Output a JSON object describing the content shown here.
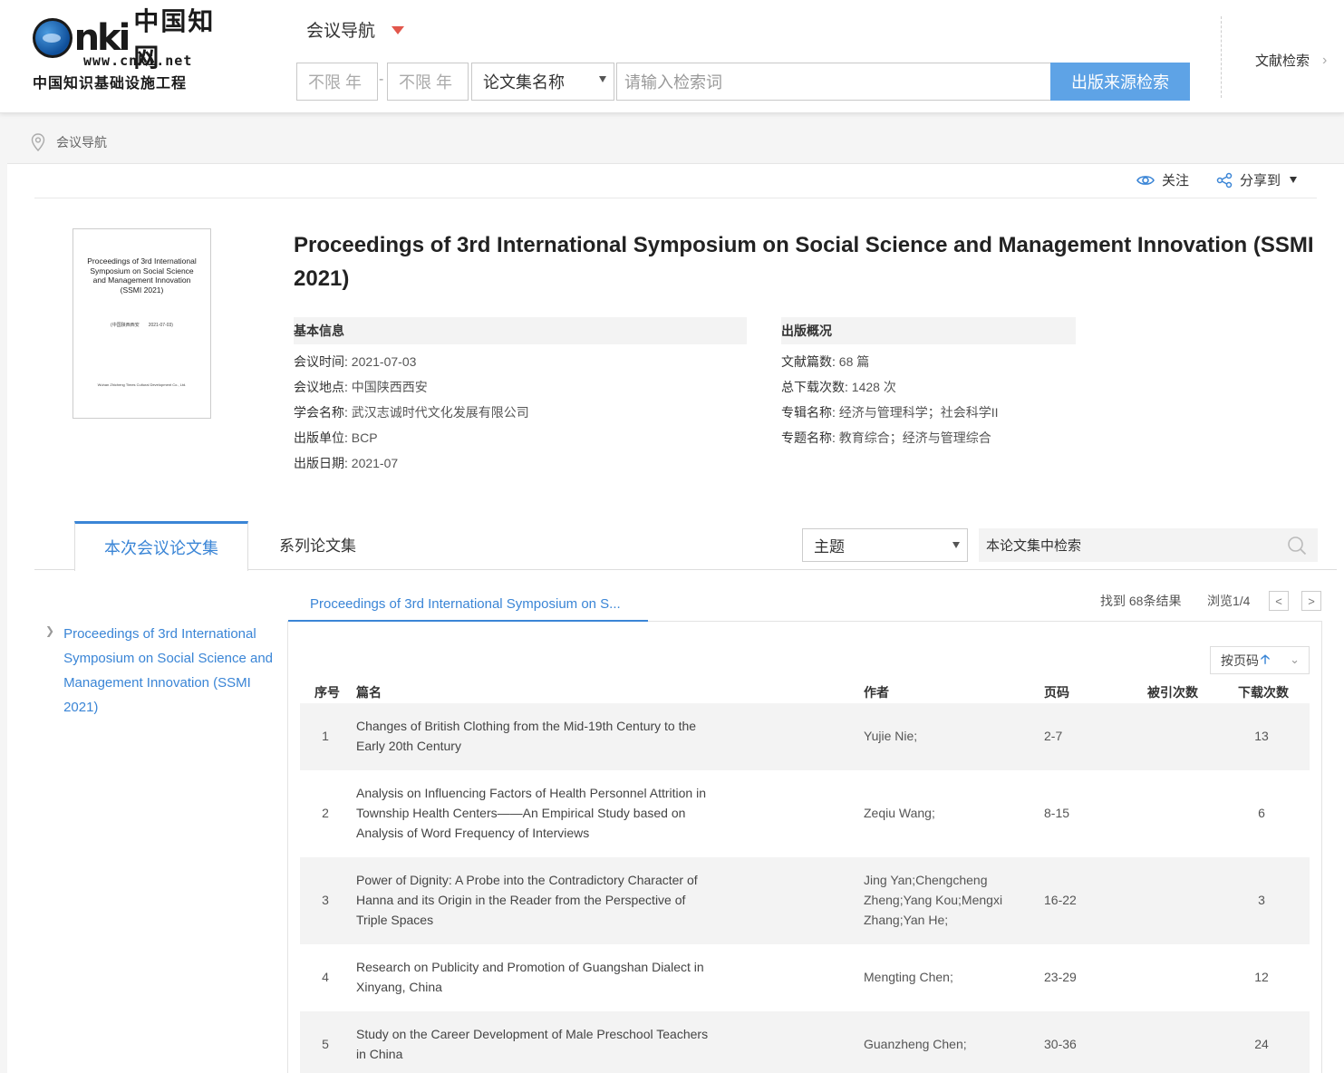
{
  "header": {
    "logo": {
      "brand": "CNKI",
      "cn_name": "中国知网",
      "url": "www.cnki.net",
      "slogan": "中国知识基础设施工程"
    },
    "nav_dropdown": "会议导航",
    "year_from": "不限 年",
    "year_to": "不限 年",
    "year_dash": "-",
    "field_select": "论文集名称",
    "keyword_placeholder": "请输入检索词",
    "search_button": "出版来源检索",
    "doc_search": "文献检索"
  },
  "breadcrumb": "会议导航",
  "actions": {
    "follow": "关注",
    "share": "分享到"
  },
  "cover": {
    "title": "Proceedings of 3rd International Symposium on Social Science and Management Innovation (SSMI 2021)",
    "location_line": "(中国陕西西安　　2021-07-03)",
    "publisher_line": "Wuhan Zhicheng Times Cultural Development Co., Ltd."
  },
  "title": "Proceedings of 3rd International Symposium on Social Science and Management Innovation (SSMI 2021)",
  "basic_info": {
    "heading": "基本信息",
    "items": [
      {
        "k": "会议时间:",
        "v": "2021-07-03"
      },
      {
        "k": "会议地点:",
        "v": "中国陕西西安"
      },
      {
        "k": "学会名称:",
        "v": "武汉志诚时代文化发展有限公司"
      },
      {
        "k": "出版单位:",
        "v": "BCP"
      },
      {
        "k": "出版日期:",
        "v": "2021-07"
      }
    ]
  },
  "pub_info": {
    "heading": "出版概况",
    "items": [
      {
        "k": "文献篇数:",
        "v": "68 篇"
      },
      {
        "k": "总下载次数:",
        "v": "1428 次"
      },
      {
        "k": "专辑名称:",
        "v": "经济与管理科学；社会科学II"
      },
      {
        "k": "专题名称:",
        "v": "教育综合；经济与管理综合"
      }
    ]
  },
  "tabs": {
    "current": "本次会议论文集",
    "series": "系列论文集"
  },
  "filter": {
    "topic": "主题",
    "search_placeholder": "本论文集中检索"
  },
  "tree": {
    "item": "Proceedings of 3rd International Symposium on Social Science and Management Innovation (SSMI 2021)"
  },
  "results": {
    "tab": "Proceedings of 3rd International Symposium on S...",
    "found": "找到 68条结果",
    "browse": "浏览1/4",
    "prev": "<",
    "next": ">",
    "sort": "按页码",
    "columns": {
      "no": "序号",
      "title": "篇名",
      "author": "作者",
      "pages": "页码",
      "cited": "被引次数",
      "downloads": "下载次数"
    },
    "rows": [
      {
        "no": "1",
        "title": "Changes of British Clothing from the Mid-19th Century to the Early 20th Century",
        "author": "Yujie Nie;",
        "pages": "2-7",
        "downloads": "13"
      },
      {
        "no": "2",
        "title": "Analysis on Influencing Factors of Health Personnel Attrition in Township Health Centers——An Empirical Study based on Analysis of Word Frequency of Interviews",
        "author": "Zeqiu Wang;",
        "pages": "8-15",
        "downloads": "6"
      },
      {
        "no": "3",
        "title": "Power of Dignity: A Probe into the Contradictory Character of Hanna and its Origin in the Reader from the Perspective of Triple Spaces",
        "author": "Jing Yan;Chengcheng Zheng;Yang Kou;Mengxi Zhang;Yan He;",
        "pages": "16-22",
        "downloads": "3"
      },
      {
        "no": "4",
        "title": "Research on Publicity and Promotion of Guangshan Dialect in Xinyang, China",
        "author": "Mengting Chen;",
        "pages": "23-29",
        "downloads": "12"
      },
      {
        "no": "5",
        "title": "Study on the Career Development of Male Preschool Teachers in China",
        "author": "Guanzheng Chen;",
        "pages": "30-36",
        "downloads": "24"
      }
    ]
  }
}
